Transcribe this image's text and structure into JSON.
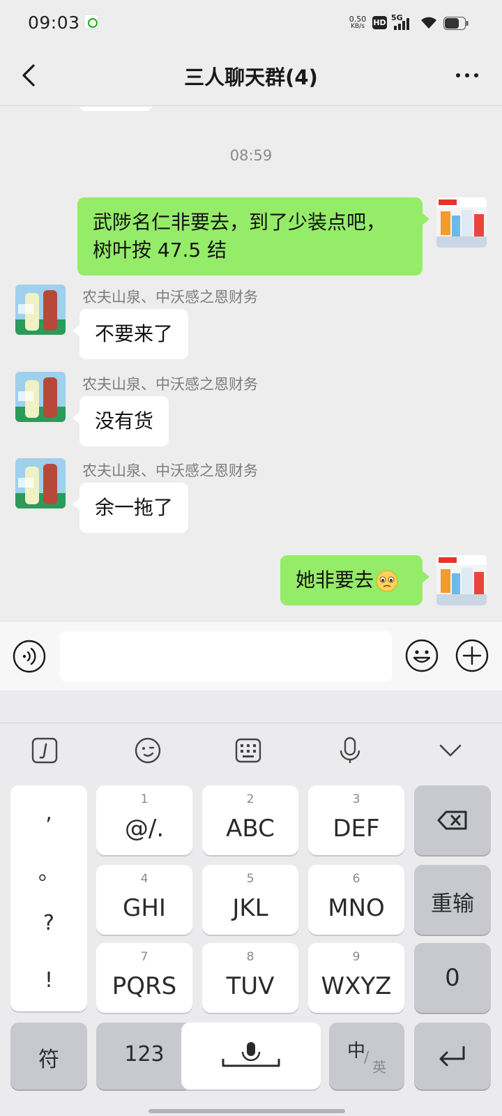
{
  "status_bar": {
    "time": "09:03",
    "net_speed_value": "0.50",
    "net_speed_unit": "KB/s",
    "hd_label": "HD",
    "network_label": "5G"
  },
  "nav": {
    "title": "三人聊天群(4)"
  },
  "chat": {
    "timestamp": "08:59",
    "messages": [
      {
        "direction": "out",
        "text_line1": "武陟名仁非要去，到了少装点吧，",
        "text_line2": "树叶按 47.5 结"
      },
      {
        "direction": "in",
        "sender": "农夫山泉、中沃感之恩财务",
        "text": "不要来了"
      },
      {
        "direction": "in",
        "sender": "农夫山泉、中沃感之恩财务",
        "text": "没有货"
      },
      {
        "direction": "in",
        "sender": "农夫山泉、中沃感之恩财务",
        "text": "余一拖了"
      },
      {
        "direction": "out",
        "text": "她非要去",
        "emoji": "pleading-face-icon"
      }
    ]
  },
  "input_bar": {
    "value": "",
    "placeholder": ""
  },
  "keyboard": {
    "punctuation": [
      ",",
      "。",
      "?",
      "!"
    ],
    "row1": [
      {
        "num": "1",
        "label": "@/."
      },
      {
        "num": "2",
        "label": "ABC"
      },
      {
        "num": "3",
        "label": "DEF"
      }
    ],
    "row2": [
      {
        "num": "4",
        "label": "GHI"
      },
      {
        "num": "5",
        "label": "JKL"
      },
      {
        "num": "6",
        "label": "MNO"
      }
    ],
    "row3": [
      {
        "num": "7",
        "label": "PQRS"
      },
      {
        "num": "8",
        "label": "TUV"
      },
      {
        "num": "9",
        "label": "WXYZ"
      }
    ],
    "reinput_label": "重输",
    "zero_label": "0",
    "symbol_label": "符",
    "num_label": "123",
    "lang_cn": "中",
    "lang_en": "英"
  },
  "colors": {
    "outgoing_bubble": "#95ec69",
    "incoming_bubble": "#ffffff",
    "background": "#ededed"
  }
}
